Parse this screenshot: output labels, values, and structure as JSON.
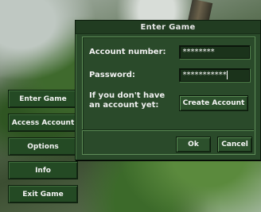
{
  "menu": {
    "items": [
      {
        "label": "Enter Game"
      },
      {
        "label": "Access Account"
      },
      {
        "label": "Options"
      },
      {
        "label": "Info"
      },
      {
        "label": "Exit Game"
      }
    ]
  },
  "dialog": {
    "title": "Enter Game",
    "account_label": "Account number:",
    "account_value": "********",
    "password_label": "Password:",
    "password_value": "***********",
    "no_account_line1": "If you don't have",
    "no_account_line2": "an account yet:",
    "create_account_label": "Create Account",
    "ok_label": "Ok",
    "cancel_label": "Cancel"
  }
}
